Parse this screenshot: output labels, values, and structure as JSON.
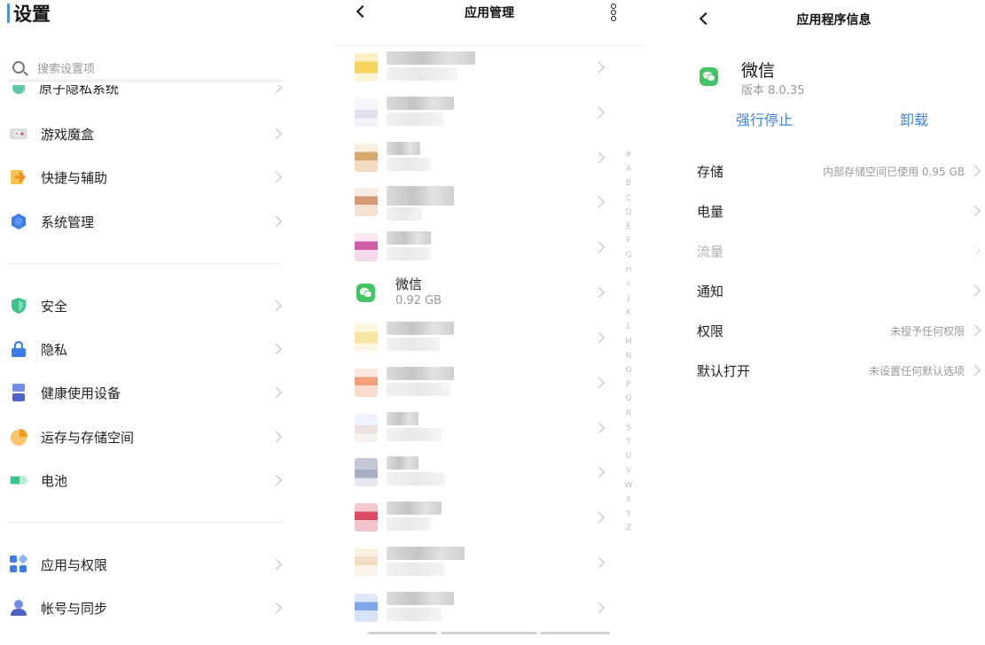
{
  "settings": {
    "title": "设置",
    "search_placeholder": "搜索设置项",
    "cut_item": "原子隐私系统",
    "group1": [
      {
        "label": "游戏魔盒",
        "icon": "game-box-icon"
      },
      {
        "label": "快捷与辅助",
        "icon": "shortcut-arrow-icon"
      },
      {
        "label": "系统管理",
        "icon": "system-hexagon-icon"
      }
    ],
    "group2": [
      {
        "label": "安全",
        "icon": "shield-icon"
      },
      {
        "label": "隐私",
        "icon": "lock-icon"
      },
      {
        "label": "健康使用设备",
        "icon": "hourglass-icon"
      },
      {
        "label": "运存与存储空间",
        "icon": "storage-pie-icon"
      },
      {
        "label": "电池",
        "icon": "battery-icon"
      }
    ],
    "group3": [
      {
        "label": "应用与权限",
        "icon": "apps-grid-icon"
      },
      {
        "label": "帐号与同步",
        "icon": "account-icon"
      }
    ]
  },
  "app_manager": {
    "title": "应用管理",
    "wechat_name": "微信",
    "wechat_size": "0.92 GB",
    "alphabet": [
      "#",
      "A",
      "B",
      "C",
      "D",
      "E",
      "F",
      "G",
      "H",
      "I",
      "J",
      "K",
      "L",
      "M",
      "N",
      "O",
      "P",
      "Q",
      "R",
      "S",
      "T",
      "U",
      "V",
      "W",
      "X",
      "Y",
      "Z"
    ]
  },
  "app_info": {
    "title": "应用程序信息",
    "app_name": "微信",
    "version": "版本 8.0.35",
    "force_stop": "强行停止",
    "uninstall": "卸载",
    "rows": [
      {
        "key": "存储",
        "value": "内部存储空间已使用 0.95 GB",
        "disabled": false
      },
      {
        "key": "电量",
        "value": "",
        "disabled": false
      },
      {
        "key": "流量",
        "value": "",
        "disabled": true
      },
      {
        "key": "通知",
        "value": "",
        "disabled": false
      },
      {
        "key": "权限",
        "value": "未授予任何权限",
        "disabled": false
      },
      {
        "key": "默认打开",
        "value": "未设置任何默认选项",
        "disabled": false
      }
    ]
  },
  "colors": {
    "accent_blue": "#3f86e0",
    "wechat_green": "#44c462",
    "title_bar_blue": "#4a90e2"
  }
}
